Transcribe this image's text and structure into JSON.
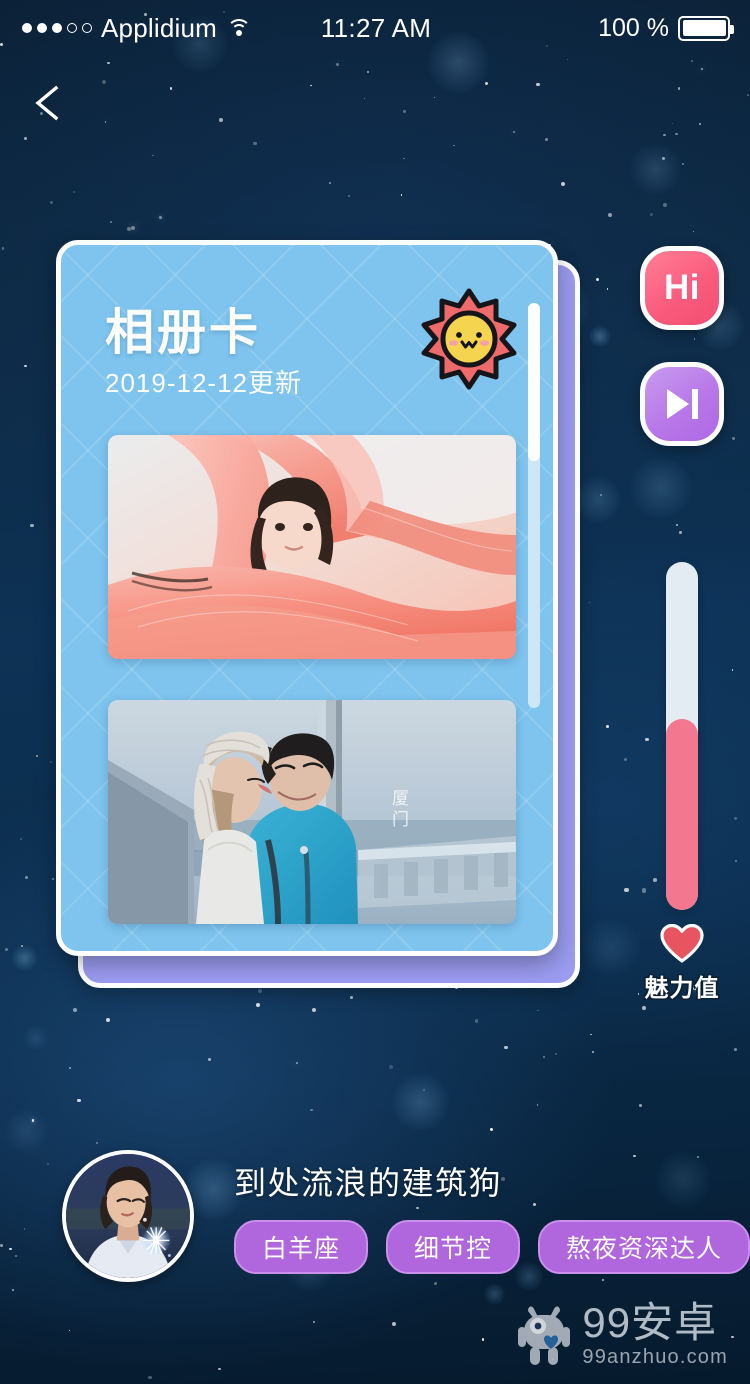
{
  "status_bar": {
    "signal_dots_filled": 3,
    "signal_dots_total": 5,
    "carrier": "Applidium",
    "wifi_icon": "wifi-icon",
    "time": "11:27 AM",
    "battery_percent": "100 %",
    "battery_level": 100
  },
  "nav": {
    "back_icon": "chevron-left-icon"
  },
  "card": {
    "title": "相册卡",
    "subtitle": "2019-12-12更新",
    "badge_icon": "sun-face-icon",
    "scroll_thumb_percent": 39,
    "photos": [
      {
        "name": "photo-girl-pink-fabric",
        "watermark": ""
      },
      {
        "name": "photo-couple-bridge",
        "watermark": "厦\n门"
      }
    ],
    "colors": {
      "front": "#7ec4ee",
      "back": "#9b9bf0",
      "border": "#ffffff"
    }
  },
  "side_actions": [
    {
      "name": "hi-button",
      "label": "Hi",
      "icon": "",
      "color": "#fa5c7d"
    },
    {
      "name": "next-button",
      "label": "",
      "icon": "skip-next-icon",
      "color": "#b878e8"
    }
  ],
  "charm": {
    "label": "魅力值",
    "heart_icon": "heart-icon",
    "fill_percent": 55,
    "fill_color": "#f2778f",
    "track_color": "#e3ecf3"
  },
  "profile": {
    "avatar_icon": "user-avatar",
    "name": "到处流浪的建筑狗",
    "tags": [
      "白羊座",
      "细节控",
      "熬夜资深达人"
    ],
    "tag_color": "#b067dd"
  },
  "watermark": {
    "logo_icon": "robot-mascot-icon",
    "title": "99安卓",
    "url": "99anzhuo.com"
  }
}
